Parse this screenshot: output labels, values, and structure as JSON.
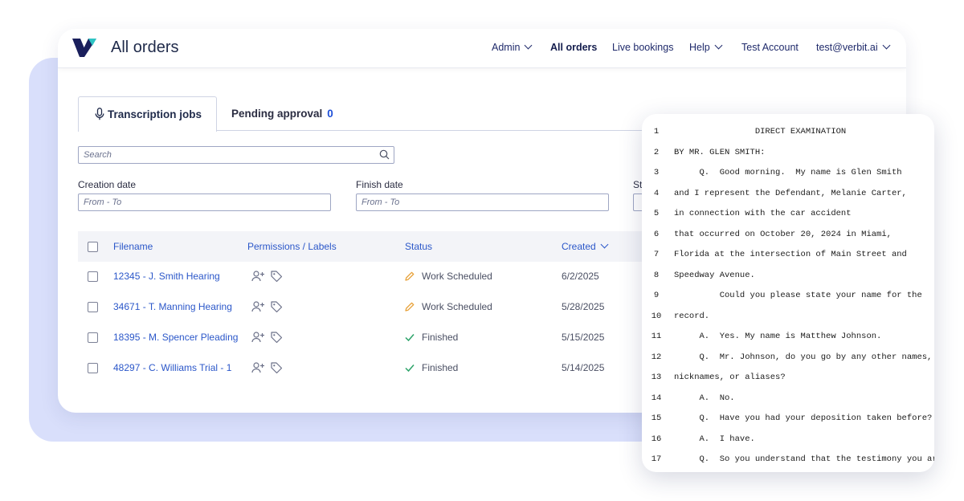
{
  "app": {
    "title": "All orders"
  },
  "nav": {
    "admin": "Admin",
    "all_orders": "All orders",
    "live_bookings": "Live bookings",
    "help": "Help",
    "account": "Test Account",
    "user": "test@verbit.ai"
  },
  "tabs": {
    "transcription": "Transcription jobs",
    "pending": "Pending approval",
    "pending_count": "0"
  },
  "search": {
    "placeholder": "Search"
  },
  "filters": {
    "creation_label": "Creation date",
    "creation_placeholder": "From - To",
    "finish_label": "Finish date",
    "finish_placeholder": "From - To",
    "status_label_partial": "St"
  },
  "table": {
    "headers": {
      "filename": "Filename",
      "permissions": "Permissions / Labels",
      "status": "Status",
      "created": "Created"
    },
    "rows": [
      {
        "filename": "12345 - J. Smith Hearing",
        "status": "Work Scheduled",
        "status_icon": "pencil-icon",
        "created": "6/2/2025"
      },
      {
        "filename": "34671 - T. Manning Hearing",
        "status": "Work Scheduled",
        "status_icon": "pencil-icon",
        "created": "5/28/2025"
      },
      {
        "filename": "18395 - M. Spencer Pleading",
        "status": "Finished",
        "status_icon": "check-icon",
        "created": "5/15/2025"
      },
      {
        "filename": "48297 - C. Williams Trial - 1",
        "status": "Finished",
        "status_icon": "check-icon",
        "created": "5/14/2025"
      }
    ]
  },
  "transcript": {
    "lines": [
      {
        "num": "1",
        "text": "                DIRECT EXAMINATION"
      },
      {
        "num": "2",
        "text": "BY MR. GLEN SMITH:"
      },
      {
        "num": "3",
        "text": "     Q.  Good morning.  My name is Glen Smith"
      },
      {
        "num": "4",
        "text": "and I represent the Defendant, Melanie Carter,"
      },
      {
        "num": "5",
        "text": "in connection with the car accident"
      },
      {
        "num": "6",
        "text": "that occurred on October 20, 2024 in Miami,"
      },
      {
        "num": "7",
        "text": "Florida at the intersection of Main Street and"
      },
      {
        "num": "8",
        "text": "Speedway Avenue."
      },
      {
        "num": "9",
        "text": "         Could you please state your name for the"
      },
      {
        "num": "10",
        "text": "record."
      },
      {
        "num": "11",
        "text": "     A.  Yes. My name is Matthew Johnson."
      },
      {
        "num": "12",
        "text": "     Q.  Mr. Johnson, do you go by any other names,"
      },
      {
        "num": "13",
        "text": "nicknames, or aliases?"
      },
      {
        "num": "14",
        "text": "     A.  No."
      },
      {
        "num": "15",
        "text": "     Q.  Have you had your deposition taken before?"
      },
      {
        "num": "16",
        "text": "     A.  I have."
      },
      {
        "num": "17",
        "text": "     Q.  So you understand that the testimony you are"
      }
    ]
  },
  "colors": {
    "accent": "#2b57c9",
    "pending_count": "#1e4fd8",
    "logo_dark": "#1a1f5c",
    "logo_teal": "#2ec4c4",
    "pencil": "#e8a23a",
    "check": "#2ea36a",
    "background_shape": "#d9dffb"
  }
}
